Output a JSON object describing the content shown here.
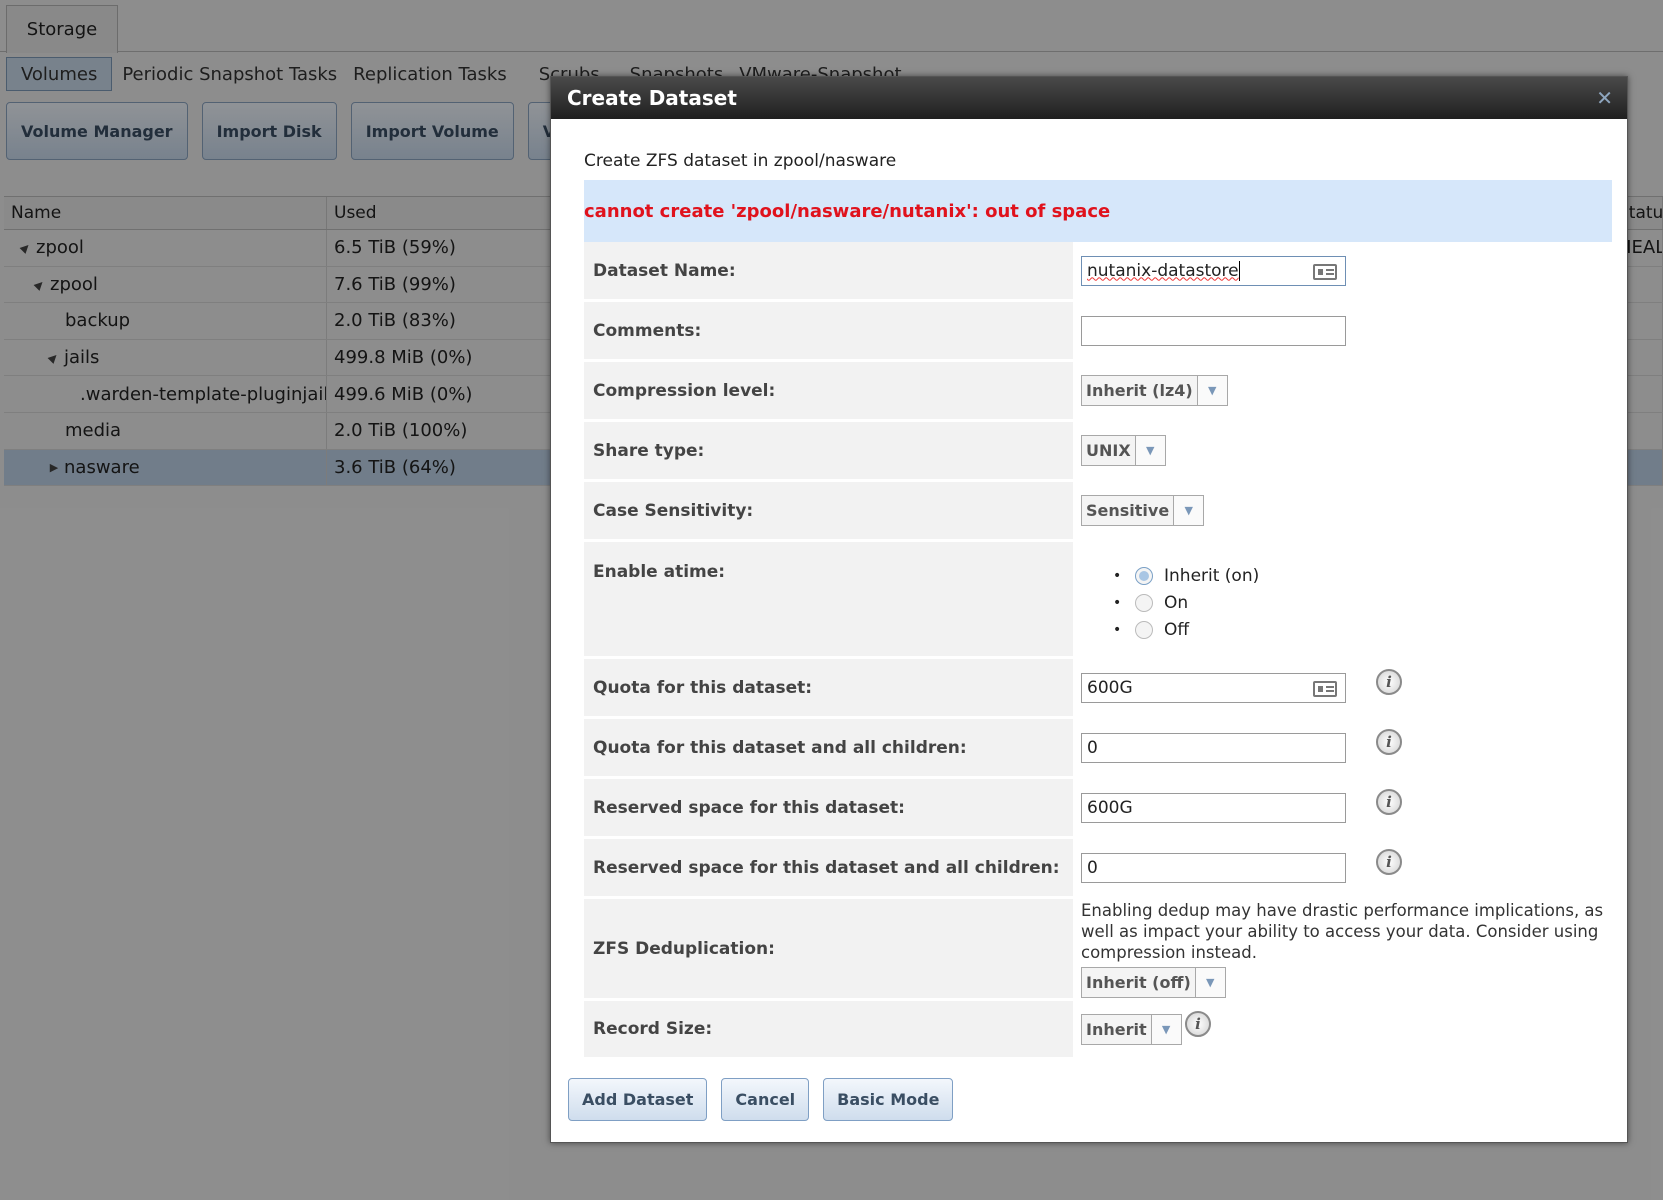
{
  "page": {
    "top_tab": "Storage",
    "subtabs": [
      "Volumes",
      "Periodic Snapshot Tasks",
      "Replication Tasks",
      "Scrubs",
      "Snapshots",
      "VMware-Snapshot"
    ],
    "toolbar": [
      "Volume Manager",
      "Import Disk",
      "Import Volume",
      "View"
    ]
  },
  "table": {
    "columns": [
      "Name",
      "Used",
      "Statu"
    ],
    "rows": [
      {
        "name": "zpool",
        "used": "6.5 TiB (59%)",
        "arrow": "▲",
        "status": "HEAL"
      },
      {
        "name": "zpool",
        "used": "7.6 TiB (99%)",
        "arrow": "▲",
        "status": ""
      },
      {
        "name": "backup",
        "used": "2.0 TiB (83%)",
        "arrow": "",
        "status": ""
      },
      {
        "name": "jails",
        "used": "499.8 MiB (0%)",
        "arrow": "▲",
        "status": ""
      },
      {
        "name": ".warden-template-pluginjail-",
        "used": "499.6 MiB (0%)",
        "arrow": "",
        "status": ""
      },
      {
        "name": "media",
        "used": "2.0 TiB (100%)",
        "arrow": "",
        "status": ""
      },
      {
        "name": "nasware",
        "used": "3.6 TiB (64%)",
        "arrow": "▶",
        "status": ""
      }
    ]
  },
  "dialog": {
    "title": "Create Dataset",
    "intro": "Create ZFS dataset in zpool/nasware",
    "error": "cannot create 'zpool/nasware/nutanix': out of space",
    "fields": {
      "dataset_name": {
        "label": "Dataset Name:",
        "value": "nutanix-datastore"
      },
      "comments": {
        "label": "Comments:",
        "value": ""
      },
      "compression": {
        "label": "Compression level:",
        "value": "Inherit (lz4)"
      },
      "share_type": {
        "label": "Share type:",
        "value": "UNIX"
      },
      "case_sensitivity": {
        "label": "Case Sensitivity:",
        "value": "Sensitive"
      },
      "atime": {
        "label": "Enable atime:",
        "options": [
          "Inherit (on)",
          "On",
          "Off"
        ],
        "selected": "Inherit (on)"
      },
      "quota": {
        "label": "Quota for this dataset:",
        "value": "600G"
      },
      "quota_children": {
        "label": "Quota for this dataset and all children:",
        "value": "0"
      },
      "reserved": {
        "label": "Reserved space for this dataset:",
        "value": "600G"
      },
      "reserved_children": {
        "label": "Reserved space for this dataset and all children:",
        "value": "0"
      },
      "dedup": {
        "label": "ZFS Deduplication:",
        "note": "Enabling dedup may have drastic performance implications, as well as impact your ability to access your data. Consider using compression instead.",
        "value": "Inherit (off)"
      },
      "record_size": {
        "label": "Record Size:",
        "value": "Inherit"
      }
    },
    "buttons": {
      "add": "Add Dataset",
      "cancel": "Cancel",
      "basic": "Basic Mode"
    }
  },
  "icons": {
    "close": "close-icon",
    "info": "info-icon",
    "card": "contact-card-icon",
    "dropdown": "chevron-down-icon"
  }
}
